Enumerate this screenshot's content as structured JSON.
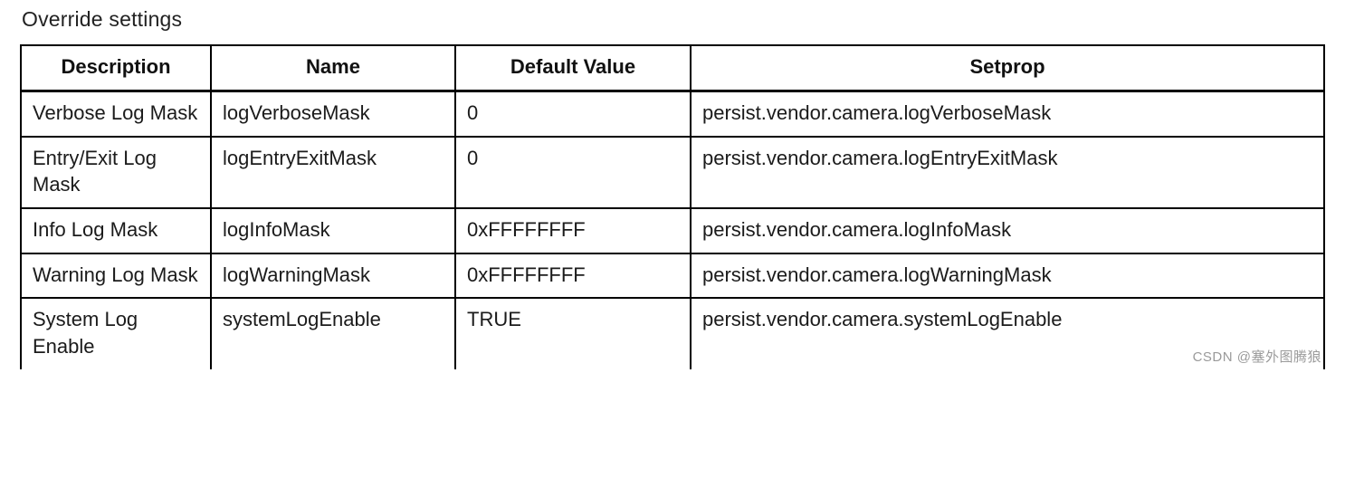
{
  "section_title": "Override settings",
  "headers": {
    "description": "Description",
    "name": "Name",
    "default_value": "Default Value",
    "setprop": "Setprop"
  },
  "rows": [
    {
      "description": "Verbose Log Mask",
      "name": "logVerboseMask",
      "default_value": "0",
      "setprop": "persist.vendor.camera.logVerboseMask"
    },
    {
      "description": "Entry/Exit Log Mask",
      "name": "logEntryExitMask",
      "default_value": "0",
      "setprop": "persist.vendor.camera.logEntryExitMask"
    },
    {
      "description": "Info Log Mask",
      "name": "logInfoMask",
      "default_value": "0xFFFFFFFF",
      "setprop": "persist.vendor.camera.logInfoMask"
    },
    {
      "description": "Warning Log Mask",
      "name": "logWarningMask",
      "default_value": "0xFFFFFFFF",
      "setprop": "persist.vendor.camera.logWarningMask"
    },
    {
      "description": "System Log Enable",
      "name": "systemLogEnable",
      "default_value": "TRUE",
      "setprop": "persist.vendor.camera.systemLogEnable"
    }
  ],
  "watermark": "CSDN @塞外图腾狼"
}
